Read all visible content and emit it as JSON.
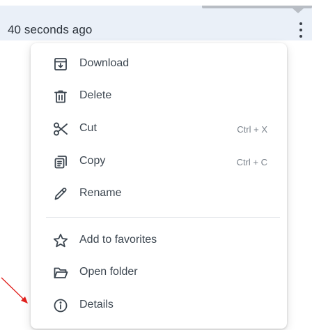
{
  "file_row": {
    "timestamp": "40 seconds ago",
    "menu_icon": "more-vertical-icon"
  },
  "menu": {
    "items": [
      {
        "label": "Download",
        "icon": "download-icon",
        "shortcut": ""
      },
      {
        "label": "Delete",
        "icon": "trash-icon",
        "shortcut": ""
      },
      {
        "label": "Cut",
        "icon": "scissors-icon",
        "shortcut": "Ctrl + X"
      },
      {
        "label": "Copy",
        "icon": "copy-icon",
        "shortcut": "Ctrl + C"
      },
      {
        "label": "Rename",
        "icon": "pencil-icon",
        "shortcut": ""
      },
      {
        "label": "Add to favorites",
        "icon": "star-icon",
        "shortcut": ""
      },
      {
        "label": "Open folder",
        "icon": "folder-open-icon",
        "shortcut": ""
      },
      {
        "label": "Details",
        "icon": "info-icon",
        "shortcut": ""
      }
    ]
  },
  "colors": {
    "row_background": "#eaf0f8",
    "text": "#3c4650",
    "shortcut_text": "#7a828b",
    "annotation_arrow": "#e0201c"
  }
}
